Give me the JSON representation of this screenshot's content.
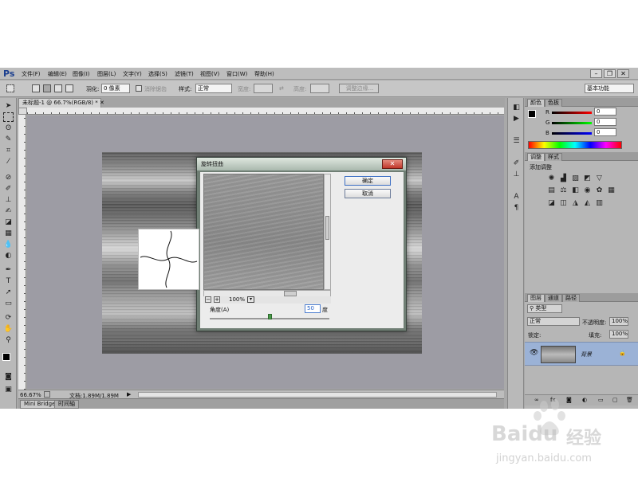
{
  "app": {
    "logo": "Ps",
    "menu": [
      "文件(F)",
      "编辑(E)",
      "图像(I)",
      "图层(L)",
      "文字(Y)",
      "选择(S)",
      "滤镜(T)",
      "视图(V)",
      "窗口(W)",
      "帮助(H)"
    ],
    "window_controls": [
      "minimize",
      "restore",
      "close"
    ]
  },
  "options": {
    "feather_label": "羽化:",
    "feather_value": "0 像素",
    "antialias_label": "消除锯齿",
    "style_label": "样式:",
    "style_value": "正常",
    "width_label": "宽度:",
    "height_label": "高度:",
    "refine_edge": "调整边缘...",
    "workspace": "基本功能"
  },
  "document": {
    "tab_title": "未标题-1 @ 66.7%(RGB/8) *",
    "zoom": "66.67%",
    "doc_info": "文档:1.89M/1.89M"
  },
  "bottom_tabs": [
    "Mini Bridge",
    "时间轴"
  ],
  "dialog": {
    "title": "旋转扭曲",
    "ok": "确定",
    "cancel": "取消",
    "preview_zoom": "100%",
    "angle_label": "角度(A)",
    "angle_value": "50",
    "angle_unit": "度"
  },
  "panels": {
    "color_tabs": [
      "颜色",
      "色板"
    ],
    "color_channels": [
      {
        "label": "R",
        "value": "0"
      },
      {
        "label": "G",
        "value": "0"
      },
      {
        "label": "B",
        "value": "0"
      }
    ],
    "adjust_tabs": [
      "调整",
      "样式"
    ],
    "adjust_title": "添加调整",
    "layers_tabs": [
      "图层",
      "通道",
      "路径"
    ],
    "kind_label": "类型",
    "blend_mode": "正常",
    "opacity_label": "不透明度:",
    "opacity_value": "100%",
    "lock_label": "锁定:",
    "fill_label": "填充:",
    "fill_value": "100%",
    "layer_name": "背景"
  },
  "watermark": {
    "brand": "Baidu",
    "brand_cn": "经验",
    "url": "jingyan.baidu.com"
  }
}
